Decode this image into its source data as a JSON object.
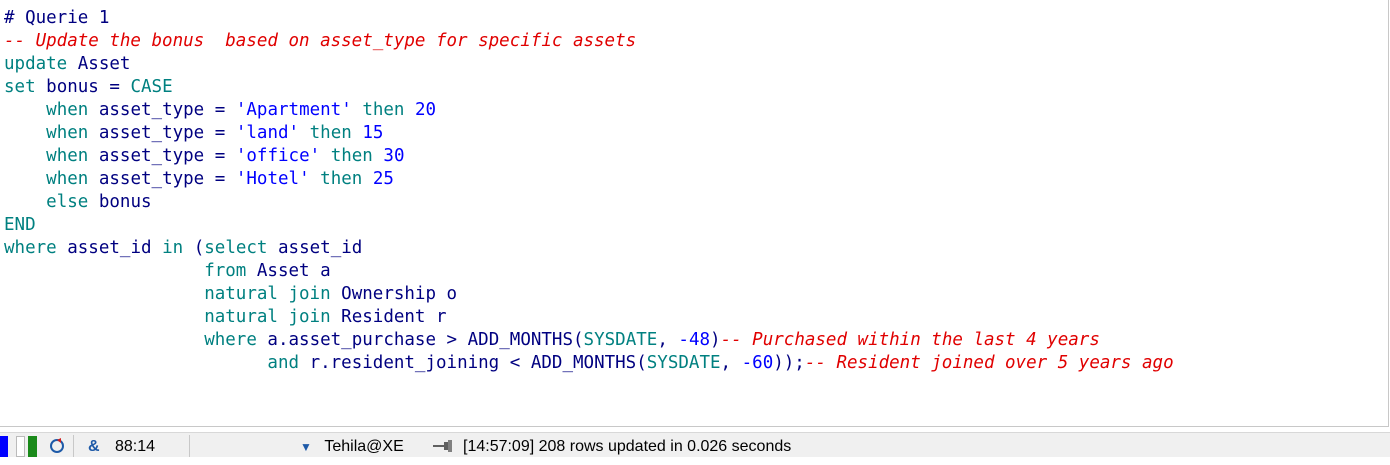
{
  "editor": {
    "comment_heading": "# Querie 1",
    "comment_desc": "-- Update the bonus  based on asset_type for specific assets",
    "cases": [
      {
        "value": "'Apartment'",
        "bonus": "20"
      },
      {
        "value": "'land'",
        "bonus": "15"
      },
      {
        "value": "'office'",
        "bonus": "30"
      },
      {
        "value": "'Hotel'",
        "bonus": "25"
      }
    ],
    "comment_purchase": "-- Purchased within the last 4 years",
    "comment_resident": "-- Resident joined over 5 years ago",
    "months_purchase": "-48",
    "months_resident": "-60"
  },
  "status": {
    "cursor_position": "88:14",
    "connection": "Tehila@XE",
    "message": "[14:57:09]  208 rows updated in 0.026 seconds",
    "colors": {
      "indicator_blue": "#0000ff",
      "indicator_green": "#1a8a1a"
    }
  }
}
